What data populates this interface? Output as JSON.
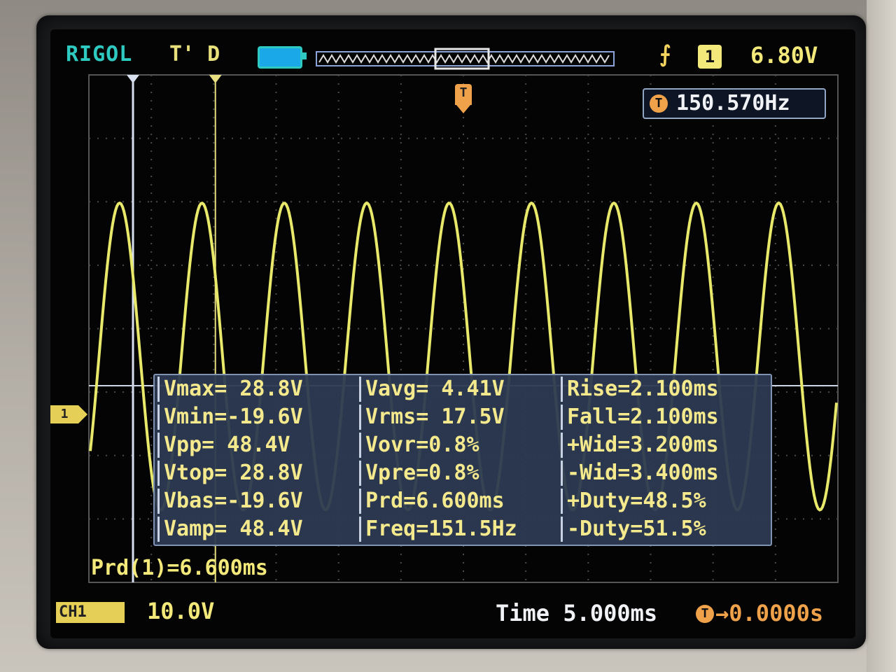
{
  "status_bar": {
    "brand": "RIGOL",
    "trigger_status": "T' D",
    "trigger_slope_icon": "rising-edge-icon",
    "trigger_source": "1",
    "trigger_level": "6.80V"
  },
  "frequency_counter": {
    "icon": "T",
    "value": "150.570Hz"
  },
  "trigger_marker": "T",
  "channel_marker": "1",
  "measurements": {
    "rows": [
      [
        "Vmax= 28.8V",
        "Vavg= 4.41V",
        "Rise=2.100ms"
      ],
      [
        "Vmin=-19.6V",
        "Vrms= 17.5V",
        "Fall=2.100ms"
      ],
      [
        "Vpp= 48.4V",
        "Vovr=0.8%",
        "+Wid=3.200ms"
      ],
      [
        "Vtop= 28.8V",
        "Vpre=0.8%",
        "-Wid=3.400ms"
      ],
      [
        "Vbas=-19.6V",
        "Prd=6.600ms",
        "+Duty=48.5%"
      ],
      [
        "Vamp= 48.4V",
        "Freq=151.5Hz",
        "-Duty=51.5%"
      ]
    ]
  },
  "cursor_readout": "Prd(1)=6.600ms",
  "bottom_bar": {
    "channel_label": "CH1",
    "volts_per_div": "10.0V",
    "timebase_label": "Time 5.000ms",
    "trigger_offset_icon": "T",
    "trigger_offset": "→0.0000s"
  },
  "colors": {
    "trace": "#e8e86a",
    "brand": "#2ec9c0",
    "trigger": "#f0a24a",
    "measure_panel": "#2c3a52"
  },
  "waveform": {
    "vmax": 28.8,
    "vmin": -19.6,
    "period_ms": 6.6,
    "time_per_div_ms": 5.0,
    "volts_per_div": 10.0
  }
}
